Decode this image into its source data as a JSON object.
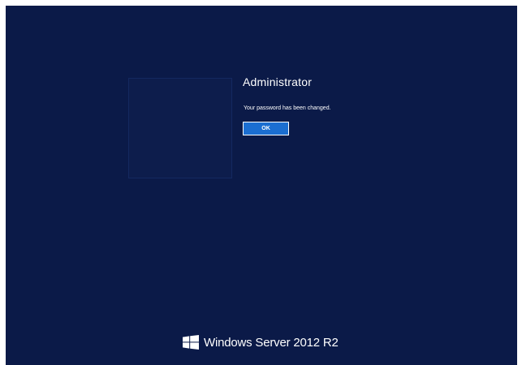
{
  "user": {
    "name": "Administrator"
  },
  "dialog": {
    "message": "Your password has been changed.",
    "ok_label": "OK"
  },
  "branding": {
    "product": "Windows Server 2012 R2",
    "logo_icon": "windows-logo-icon"
  },
  "colors": {
    "background": "#0b1a48",
    "button": "#1b6ed1",
    "text": "#ffffff"
  }
}
